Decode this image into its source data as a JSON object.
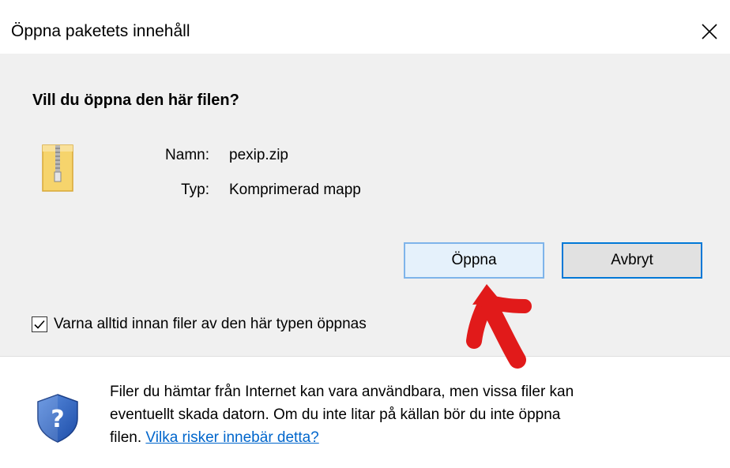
{
  "dialog": {
    "title": "Öppna paketets innehåll",
    "heading": "Vill du öppna den här filen?",
    "file": {
      "name_label": "Namn:",
      "name_value": "pexip.zip",
      "type_label": "Typ:",
      "type_value": "Komprimerad mapp",
      "icon": "zip-folder-icon"
    },
    "buttons": {
      "open": "Öppna",
      "cancel": "Avbryt"
    },
    "checkbox": {
      "label": "Varna alltid innan filer av den här typen öppnas",
      "checked": true
    },
    "warning": {
      "text_1": "Filer du hämtar från Internet kan vara användbara, men vissa filer kan",
      "text_2": "eventuellt skada datorn. Om du inte litar på källan bör du inte öppna",
      "text_3": "filen. ",
      "link": "Vilka risker innebär detta?",
      "icon": "security-shield-icon"
    },
    "annotation": {
      "icon": "red-arrow-annotation",
      "color": "#e11a1a"
    },
    "colors": {
      "accent": "#0078d7",
      "background": "#f0f0f0",
      "link": "#0066cc"
    }
  }
}
